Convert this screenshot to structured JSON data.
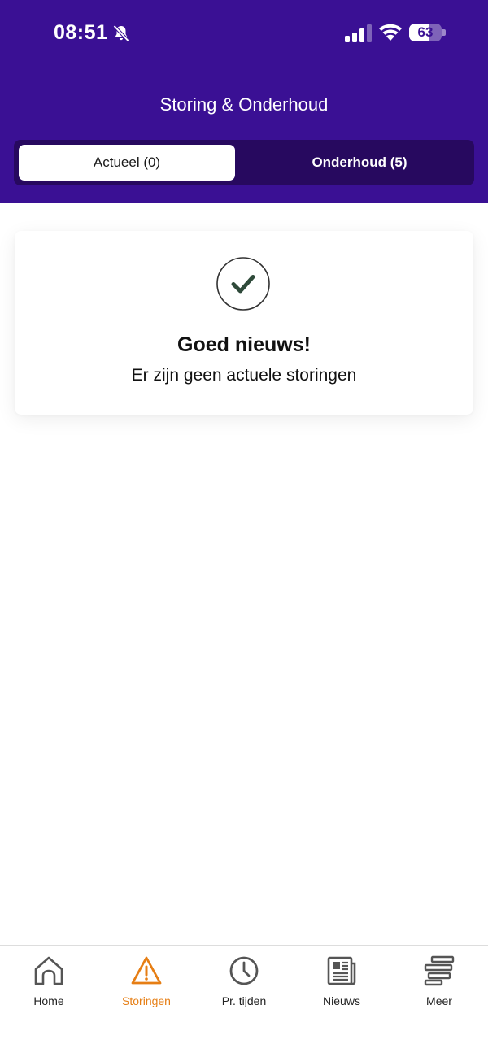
{
  "status_bar": {
    "time": "08:51",
    "battery_percent": 63,
    "battery_label": "63",
    "icons": [
      "bell-slash-icon",
      "signal-icon",
      "wifi-icon",
      "battery-icon"
    ]
  },
  "header": {
    "title": "Storing & Onderhoud",
    "background_color": "#3a1094"
  },
  "tabs": [
    {
      "label": "Actueel (0)",
      "selected": true
    },
    {
      "label": "Onderhoud (5)",
      "selected": false
    }
  ],
  "status_card": {
    "icon": "check-circle-icon",
    "title": "Goed nieuws!",
    "message": "Er zijn geen actuele storingen"
  },
  "bottom_nav": {
    "active_color": "#e67e14",
    "items": [
      {
        "label": "Home",
        "icon": "home-icon",
        "active": false
      },
      {
        "label": "Storingen",
        "icon": "warning-icon",
        "active": true
      },
      {
        "label": "Pr. tijden",
        "icon": "clock-icon",
        "active": false
      },
      {
        "label": "Nieuws",
        "icon": "newspaper-icon",
        "active": false
      },
      {
        "label": "Meer",
        "icon": "menu-stack-icon",
        "active": false
      }
    ]
  }
}
